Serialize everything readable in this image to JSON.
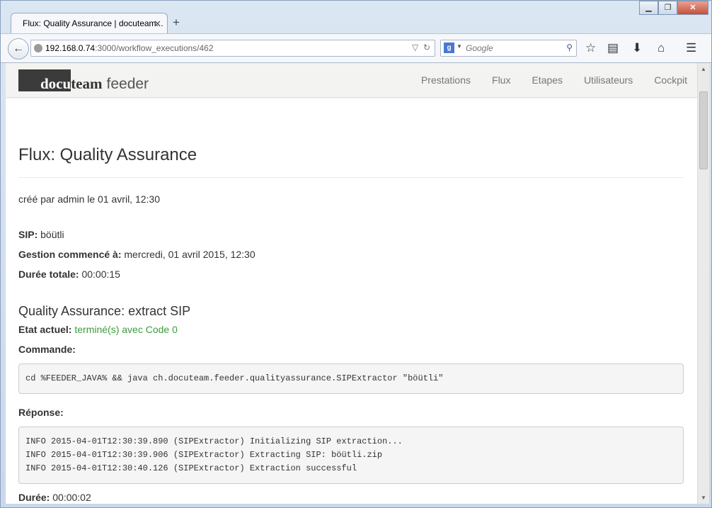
{
  "browser": {
    "tab_title": "Flux: Quality Assurance | docuteam...",
    "url_host": "192.168.0.74",
    "url_path": ":3000/workflow_executions/462",
    "search_placeholder": "Google"
  },
  "site": {
    "logo_docu": "docu",
    "logo_team": "team",
    "logo_feeder": "feeder",
    "menu": [
      "Prestations",
      "Flux",
      "Etapes",
      "Utilisateurs",
      "Cockpit"
    ]
  },
  "page": {
    "title": "Flux: Quality Assurance",
    "created": "créé par admin le 01 avril, 12:30",
    "sip_label": "SIP:",
    "sip_value": "böütli",
    "started_label": "Gestion commencé à:",
    "started_value": "mercredi, 01 avril 2015, 12:30",
    "duration_label": "Durée totale:",
    "duration_value": "00:00:15"
  },
  "step": {
    "title": "Quality Assurance: extract SIP",
    "state_label": "Etat actuel:",
    "state_value": "terminé(s) avec Code 0",
    "command_label": "Commande:",
    "command": "cd %FEEDER_JAVA% && java ch.docuteam.feeder.qualityassurance.SIPExtractor \"böütli\"",
    "response_label": "Réponse:",
    "response": "INFO 2015-04-01T12:30:39.890 (SIPExtractor) Initializing SIP extraction...\nINFO 2015-04-01T12:30:39.906 (SIPExtractor) Extracting SIP: böütli.zip\nINFO 2015-04-01T12:30:40.126 (SIPExtractor) Extraction successful",
    "duration_label": "Durée:",
    "duration_value": "00:00:02"
  },
  "colors": {
    "status_green": "#3c9d3c",
    "logo_dark": "#3b3b3b"
  }
}
